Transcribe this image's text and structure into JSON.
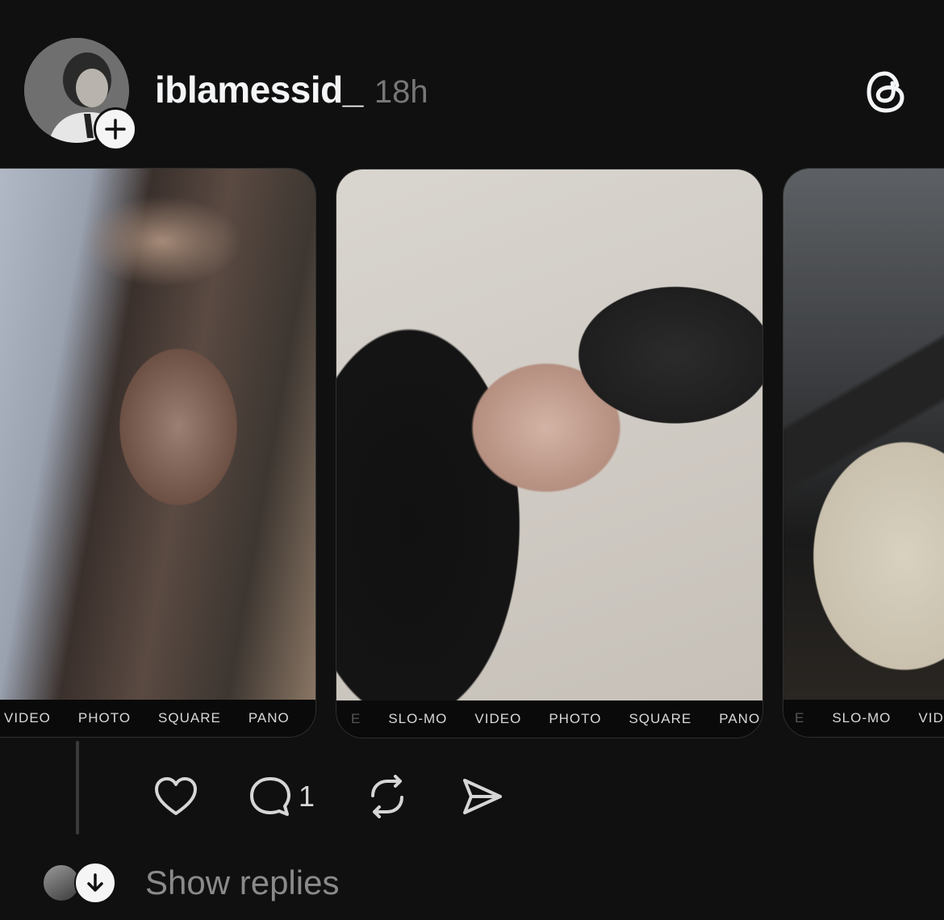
{
  "header": {
    "username": "iblamessid_",
    "time": "18h",
    "avatar_icon": "user-avatar",
    "follow_icon": "plus-icon",
    "logo_icon": "threads-logo-icon"
  },
  "carousel": {
    "cards": [
      {
        "modes": [
          "VIDEO",
          "PHOTO",
          "SQUARE",
          "PANO"
        ]
      },
      {
        "modes": [
          "SLO-MO",
          "VIDEO",
          "PHOTO",
          "SQUARE",
          "PANO"
        ]
      },
      {
        "modes": [
          "SLO-MO",
          "VIDEO"
        ]
      }
    ]
  },
  "actions": {
    "like_icon": "heart-icon",
    "comment_icon": "comment-icon",
    "comment_count": "1",
    "repost_icon": "repost-icon",
    "share_icon": "send-icon"
  },
  "replies": {
    "label": "Show replies",
    "icon": "arrow-down-icon"
  },
  "colors": {
    "background": "#101010",
    "text": "#f3f5f7",
    "muted": "#777777"
  }
}
